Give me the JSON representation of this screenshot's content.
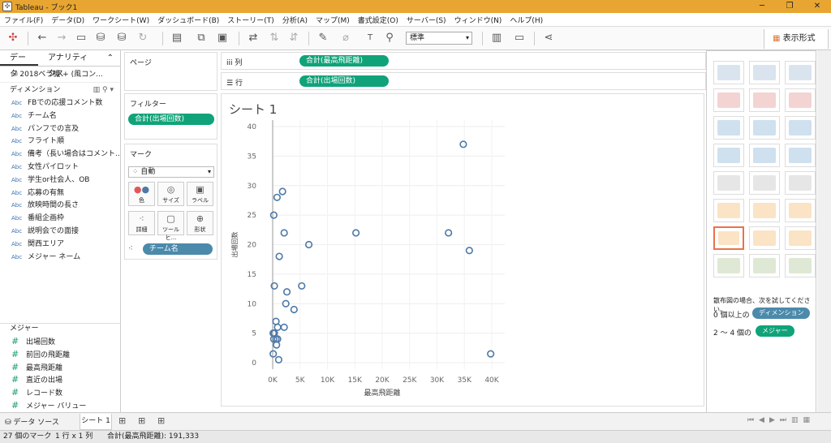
{
  "window": {
    "title": "Tableau - ブック1"
  },
  "menu": [
    "ファイル(F)",
    "データ(D)",
    "ワークシート(W)",
    "ダッシュボード(B)",
    "ストーリー(T)",
    "分析(A)",
    "マップ(M)",
    "書式設定(O)",
    "サーバー(S)",
    "ウィンドウ(N)",
    "ヘルプ(H)"
  ],
  "toolbar": {
    "standard_label": "標準",
    "showme_label": "表示形式"
  },
  "leftpane": {
    "tab_data": "データ",
    "tab_analytics": "アナリティクス",
    "datasource": "2018ベラ機 + (風コン...",
    "dimensions_header": "ディメンション",
    "dimensions": [
      "FBでの応援コメント数",
      "チーム名",
      "パンフでの言及",
      "フライト順",
      "備考（長い場合はコメント...",
      "女性パイロット",
      "学生or社会人、OB",
      "応募の有無",
      "放映時間の長さ",
      "番組企画枠",
      "説明会での面接",
      "関西エリア",
      "メジャー ネーム"
    ],
    "dim_type": "Abc",
    "measures_header": "メジャー",
    "measures": [
      "出場回数",
      "前回の飛距離",
      "最高飛距離",
      "直近の出場",
      "レコード数",
      "メジャー バリュー"
    ],
    "measure_type": "#"
  },
  "cards": {
    "pages": "ページ",
    "filters": "フィルター",
    "filter_pill": "合計(出場回数)",
    "marks": "マーク",
    "marks_type": "自動",
    "mark_buttons": [
      "色",
      "サイズ",
      "ラベル",
      "詳細",
      "ツールヒ...",
      "形状"
    ],
    "detail_pill": "チーム名"
  },
  "shelves": {
    "columns_label": "列",
    "columns_pill": "合計(最高飛距離)",
    "rows_label": "行",
    "rows_pill": "合計(出場回数)"
  },
  "sheet": {
    "title": "シート 1"
  },
  "chart_data": {
    "type": "scatter",
    "xlabel": "最高飛距離",
    "ylabel": "出場回数",
    "xlim": [
      0,
      40000
    ],
    "ylim": [
      0,
      40
    ],
    "xticks": [
      0,
      5000,
      10000,
      15000,
      20000,
      25000,
      30000,
      35000,
      40000
    ],
    "xtick_labels": [
      "0K",
      "5K",
      "10K",
      "15K",
      "20K",
      "25K",
      "30K",
      "35K",
      "40K"
    ],
    "yticks": [
      0,
      5,
      10,
      15,
      20,
      25,
      30,
      35,
      40
    ],
    "grid": true,
    "marker_color": "#4e79a7",
    "points": [
      {
        "x": 34800,
        "y": 37
      },
      {
        "x": 1800,
        "y": 29
      },
      {
        "x": 800,
        "y": 28
      },
      {
        "x": 200,
        "y": 25
      },
      {
        "x": 2100,
        "y": 22
      },
      {
        "x": 15200,
        "y": 22
      },
      {
        "x": 32100,
        "y": 22
      },
      {
        "x": 6600,
        "y": 20
      },
      {
        "x": 35900,
        "y": 19
      },
      {
        "x": 1200,
        "y": 18
      },
      {
        "x": 300,
        "y": 13
      },
      {
        "x": 5300,
        "y": 13
      },
      {
        "x": 2600,
        "y": 12
      },
      {
        "x": 2400,
        "y": 10
      },
      {
        "x": 3900,
        "y": 9
      },
      {
        "x": 600,
        "y": 7
      },
      {
        "x": 2100,
        "y": 6
      },
      {
        "x": 900,
        "y": 6
      },
      {
        "x": 100,
        "y": 5
      },
      {
        "x": 300,
        "y": 5
      },
      {
        "x": 200,
        "y": 4
      },
      {
        "x": 600,
        "y": 4
      },
      {
        "x": 900,
        "y": 4
      },
      {
        "x": 700,
        "y": 3
      },
      {
        "x": 100,
        "y": 1.5
      },
      {
        "x": 1100,
        "y": 0.5
      },
      {
        "x": 39800,
        "y": 1.5
      }
    ]
  },
  "showme": {
    "hint": "散布図の場合、次を試してください。",
    "dim_req_prefix": "0 個以上の",
    "dim_pill": "ディメンション",
    "mea_req_prefix": "2 ～ 4 個の",
    "mea_pill": "メジャー"
  },
  "bottom": {
    "datasource_tab": "データ ソース",
    "sheet_tab": "シート 1",
    "status_marks": "27 個のマーク",
    "status_grid": "1 行 x 1 列",
    "status_sum": "合計(最高飛距離): 191,333"
  }
}
